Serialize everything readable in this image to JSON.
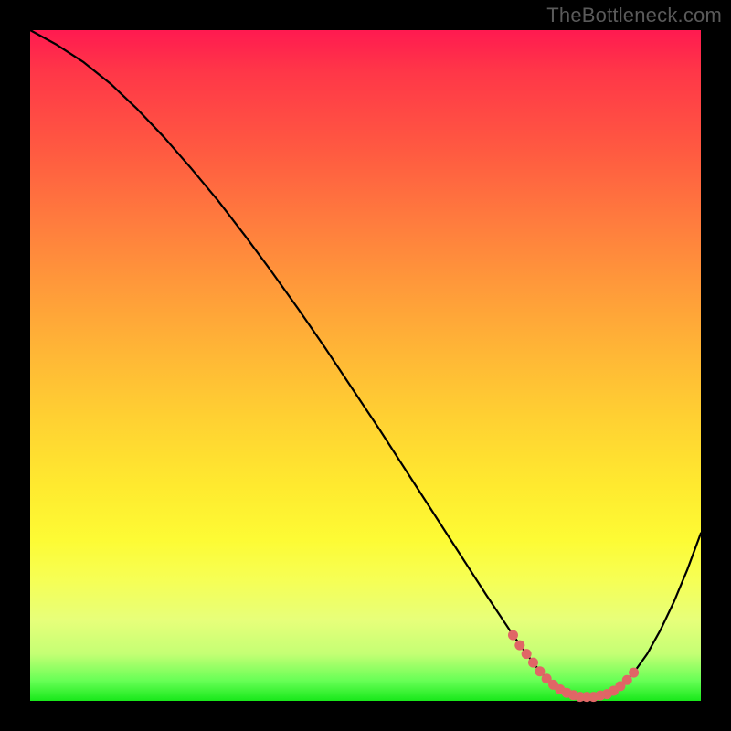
{
  "watermark": "TheBottleneck.com",
  "chart_data": {
    "type": "line",
    "title": "",
    "xlabel": "",
    "ylabel": "",
    "xlim": [
      0,
      100
    ],
    "ylim": [
      0,
      100
    ],
    "grid": false,
    "series": [
      {
        "name": "bottleneck-curve",
        "x": [
          0,
          4,
          8,
          12,
          16,
          20,
          24,
          28,
          32,
          36,
          40,
          44,
          48,
          52,
          56,
          60,
          64,
          68,
          72,
          74,
          76,
          78,
          80,
          82,
          84,
          86,
          88,
          90,
          92,
          94,
          96,
          98,
          100
        ],
        "y": [
          100,
          97.8,
          95.2,
          92.0,
          88.2,
          84.0,
          79.4,
          74.6,
          69.4,
          64.0,
          58.4,
          52.6,
          46.6,
          40.6,
          34.4,
          28.2,
          22.0,
          15.8,
          9.8,
          7.0,
          4.4,
          2.4,
          1.2,
          0.6,
          0.6,
          1.0,
          2.2,
          4.2,
          7.0,
          10.6,
          14.8,
          19.6,
          25.0
        ]
      }
    ],
    "markers": {
      "name": "highlight-range",
      "color": "#e06666",
      "points": [
        {
          "x": 72,
          "y": 9.8
        },
        {
          "x": 73,
          "y": 8.3
        },
        {
          "x": 74,
          "y": 7.0
        },
        {
          "x": 75,
          "y": 5.7
        },
        {
          "x": 76,
          "y": 4.4
        },
        {
          "x": 77,
          "y": 3.3
        },
        {
          "x": 78,
          "y": 2.4
        },
        {
          "x": 79,
          "y": 1.7
        },
        {
          "x": 80,
          "y": 1.2
        },
        {
          "x": 81,
          "y": 0.85
        },
        {
          "x": 82,
          "y": 0.6
        },
        {
          "x": 83,
          "y": 0.6
        },
        {
          "x": 84,
          "y": 0.6
        },
        {
          "x": 85,
          "y": 0.8
        },
        {
          "x": 86,
          "y": 1.0
        },
        {
          "x": 87,
          "y": 1.5
        },
        {
          "x": 88,
          "y": 2.2
        },
        {
          "x": 89,
          "y": 3.1
        },
        {
          "x": 90,
          "y": 4.2
        }
      ]
    }
  }
}
